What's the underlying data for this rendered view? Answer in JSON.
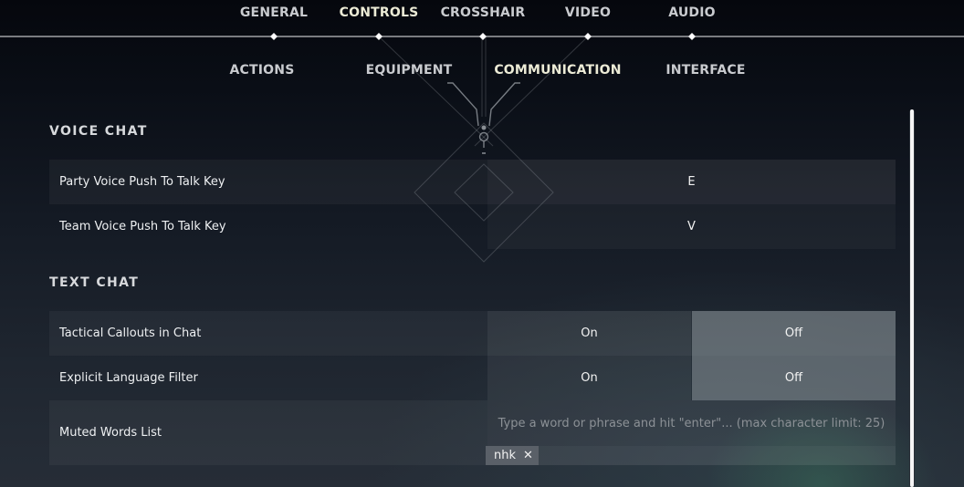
{
  "top_tabs": [
    {
      "label": "GENERAL",
      "active": false
    },
    {
      "label": "CONTROLS",
      "active": true
    },
    {
      "label": "CROSSHAIR",
      "active": false
    },
    {
      "label": "VIDEO",
      "active": false
    },
    {
      "label": "AUDIO",
      "active": false
    }
  ],
  "sub_tabs": [
    {
      "label": "ACTIONS",
      "active": false
    },
    {
      "label": "EQUIPMENT",
      "active": false
    },
    {
      "label": "COMMUNICATION",
      "active": true
    },
    {
      "label": "INTERFACE",
      "active": false
    }
  ],
  "voice_chat": {
    "title": "VOICE CHAT",
    "rows": [
      {
        "label": "Party Voice Push To Talk Key",
        "value": "E"
      },
      {
        "label": "Team Voice Push To Talk Key",
        "value": "V"
      }
    ]
  },
  "text_chat": {
    "title": "TEXT CHAT",
    "rows": [
      {
        "label": "Tactical Callouts in Chat",
        "on_label": "On",
        "off_label": "Off",
        "selected": "Off"
      },
      {
        "label": "Explicit Language Filter",
        "on_label": "On",
        "off_label": "Off",
        "selected": "Off"
      }
    ],
    "muted_words": {
      "label": "Muted Words List",
      "value": "",
      "placeholder": "Type a word or phrase and hit \"enter\"... (max character limit: 25)",
      "tags": [
        {
          "text": "nhk",
          "remove_glyph": "✕"
        }
      ]
    }
  },
  "colors": {
    "active_tab": "#ecebd6",
    "inactive_tab": "#c9cbcf",
    "selected_toggle": "#8c969b"
  }
}
